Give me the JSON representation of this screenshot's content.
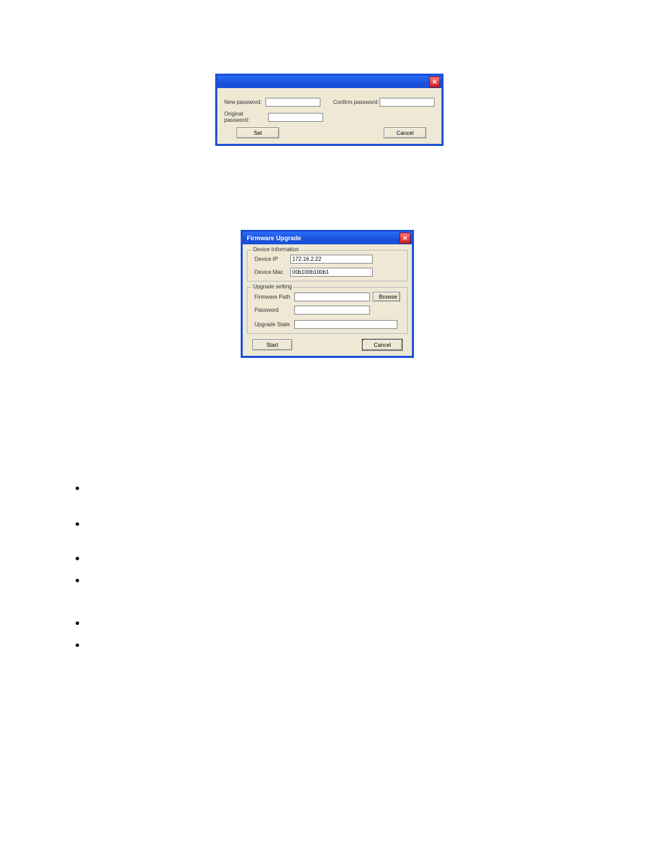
{
  "dialog1": {
    "title": "",
    "new_password_label": "New password:",
    "confirm_password_label": "Confirm password:",
    "original_password_label": "Original password:",
    "set_btn": "Set",
    "cancel_btn": "Cancel"
  },
  "dialog2": {
    "title": "Firmware Upgrade",
    "device_info_legend": "Device Information",
    "device_ip_label": "Device IP",
    "device_ip_value": "172.16.2.22",
    "device_mac_label": "Device Mac",
    "device_mac_value": "00b100b100b1",
    "upgrade_setting_legend": "Upgrade setting",
    "firmware_path_label": "Firmware Path",
    "browse_btn": "Browse",
    "password_label": "Password",
    "upgrade_state_label": "Upgrade State",
    "start_btn": "Start",
    "cancel_btn": "Cancel"
  }
}
